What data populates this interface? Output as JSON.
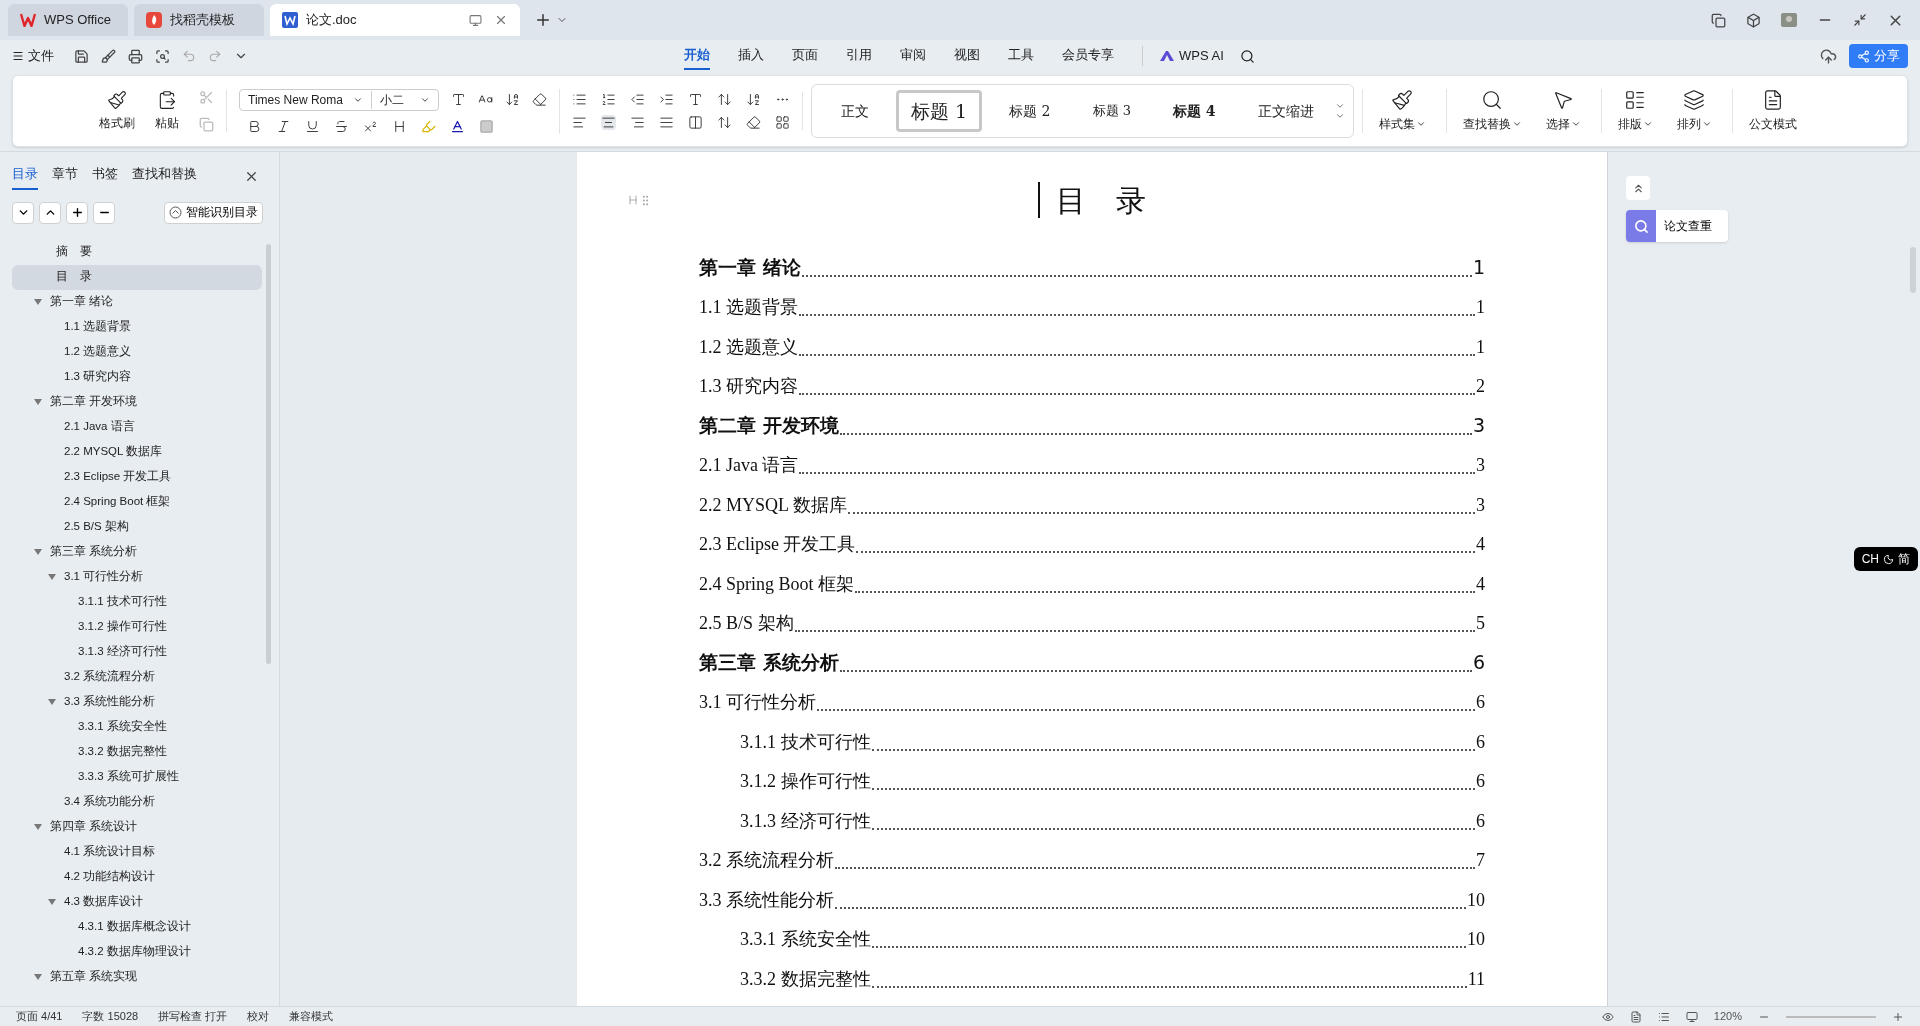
{
  "tabs": [
    {
      "kind": "wps",
      "label": "WPS Office",
      "selected": false
    },
    {
      "kind": "template",
      "label": "找稻壳模板",
      "selected": false
    },
    {
      "kind": "doc",
      "label": "论文.doc",
      "selected": true
    }
  ],
  "file_menu": "文件",
  "ribbon_tabs": [
    {
      "label": "开始",
      "selected": true
    },
    {
      "label": "插入",
      "selected": false
    },
    {
      "label": "页面",
      "selected": false
    },
    {
      "label": "引用",
      "selected": false
    },
    {
      "label": "审阅",
      "selected": false
    },
    {
      "label": "视图",
      "selected": false
    },
    {
      "label": "工具",
      "selected": false
    },
    {
      "label": "会员专享",
      "selected": false
    }
  ],
  "ai_button": "WPS AI",
  "share_button": "分享",
  "ribbon": {
    "clipboard": [
      "格式刷",
      "粘贴"
    ],
    "font_name": "Times New Roma",
    "font_size": "小二",
    "styles": [
      {
        "kind": "body",
        "label": "正文",
        "selected": false
      },
      {
        "kind": "h1",
        "label": "标题 1",
        "selected": true
      },
      {
        "kind": "h2",
        "label": "标题 2",
        "selected": false
      },
      {
        "kind": "h3",
        "label": "标题 3",
        "selected": false
      },
      {
        "kind": "h4",
        "label": "标题 4",
        "selected": false
      },
      {
        "kind": "body",
        "label": "正文缩进",
        "selected": false
      }
    ],
    "tools": [
      {
        "kind": "style-set",
        "label": "样式集",
        "menu": true
      },
      {
        "kind": "find",
        "label": "查找替换",
        "menu": true
      },
      {
        "kind": "select",
        "label": "选择",
        "menu": true
      },
      {
        "kind": "layout",
        "label": "排版",
        "menu": true
      },
      {
        "kind": "arrange",
        "label": "排列",
        "menu": true
      },
      {
        "kind": "official",
        "label": "公文模式",
        "menu": false
      }
    ]
  },
  "sidebar": {
    "tabs": [
      {
        "label": "目录",
        "selected": true
      },
      {
        "label": "章节",
        "selected": false
      },
      {
        "label": "书签",
        "selected": false
      },
      {
        "label": "查找和替换",
        "selected": false
      }
    ],
    "smart_button": "智能识别目录",
    "outline": [
      {
        "label": "摘　要",
        "selected": false
      },
      {
        "label": "目　录",
        "selected": true
      },
      {
        "label": "第一章  绪论",
        "selected": false,
        "expanded": true,
        "children": [
          {
            "label": "1.1  选题背景",
            "selected": false
          },
          {
            "label": "1.2  选题意义",
            "selected": false
          },
          {
            "label": "1.3  研究内容",
            "selected": false
          }
        ]
      },
      {
        "label": "第二章  开发环境",
        "selected": false,
        "expanded": true,
        "children": [
          {
            "label": "2.1 Java 语言",
            "selected": false
          },
          {
            "label": "2.2 MYSQL 数据库",
            "selected": false
          },
          {
            "label": "2.3 Eclipse 开发工具",
            "selected": false
          },
          {
            "label": "2.4 Spring Boot 框架",
            "selected": false
          },
          {
            "label": "2.5 B/S 架构",
            "selected": false
          }
        ]
      },
      {
        "label": "第三章  系统分析",
        "selected": false,
        "expanded": true,
        "children": [
          {
            "label": "3.1 可行性分析",
            "selected": false,
            "expanded": true,
            "children": [
              {
                "label": "3.1.1 技术可行性",
                "selected": false
              },
              {
                "label": "3.1.2 操作可行性",
                "selected": false
              },
              {
                "label": "3.1.3 经济可行性",
                "selected": false
              }
            ]
          },
          {
            "label": "3.2 系统流程分析",
            "selected": false
          },
          {
            "label": "3.3 系统性能分析",
            "selected": false,
            "expanded": true,
            "children": [
              {
                "label": "3.3.1 系统安全性",
                "selected": false
              },
              {
                "label": "3.3.2 数据完整性",
                "selected": false
              },
              {
                "label": "3.3.3 系统可扩展性",
                "selected": false
              }
            ]
          },
          {
            "label": "3.4 系统功能分析",
            "selected": false
          }
        ]
      },
      {
        "label": "第四章  系统设计",
        "selected": false,
        "expanded": true,
        "children": [
          {
            "label": "4.1  系统设计目标",
            "selected": false
          },
          {
            "label": "4.2 功能结构设计",
            "selected": false
          },
          {
            "label": "4.3 数据库设计",
            "selected": false,
            "expanded": true,
            "children": [
              {
                "label": "4.3.1  数据库概念设计",
                "selected": false
              },
              {
                "label": "4.3.2  数据库物理设计",
                "selected": false
              }
            ]
          }
        ]
      },
      {
        "label": "第五章  系统实现",
        "selected": false,
        "expanded": true
      }
    ]
  },
  "document": {
    "title": "目　录",
    "toc": [
      {
        "kind": "chapter",
        "label": "第一章  绪论",
        "page": "1"
      },
      {
        "kind": "section",
        "label": "1.1  选题背景",
        "page": "1"
      },
      {
        "kind": "section",
        "label": "1.2  选题意义",
        "page": "1"
      },
      {
        "kind": "section",
        "label": "1.3  研究内容",
        "page": "2"
      },
      {
        "kind": "chapter",
        "label": "第二章  开发环境",
        "page": "3"
      },
      {
        "kind": "section",
        "label": "2.1 Java 语言",
        "page": "3"
      },
      {
        "kind": "section",
        "label": "2.2 MYSQL 数据库",
        "page": "3"
      },
      {
        "kind": "section",
        "label": "2.3 Eclipse 开发工具",
        "page": "4"
      },
      {
        "kind": "section",
        "label": "2.4 Spring Boot 框架",
        "page": "4"
      },
      {
        "kind": "section",
        "label": "2.5 B/S 架构",
        "page": "5"
      },
      {
        "kind": "chapter",
        "label": "第三章  系统分析",
        "page": "6"
      },
      {
        "kind": "section",
        "label": "3.1 可行性分析",
        "page": "6"
      },
      {
        "kind": "subsection",
        "label": "3.1.1 技术可行性",
        "page": "6"
      },
      {
        "kind": "subsection",
        "label": "3.1.2 操作可行性",
        "page": "6"
      },
      {
        "kind": "subsection",
        "label": "3.1.3 经济可行性",
        "page": "6"
      },
      {
        "kind": "section",
        "label": "3.2 系统流程分析",
        "page": "7"
      },
      {
        "kind": "section",
        "label": "3.3 系统性能分析",
        "page": "10"
      },
      {
        "kind": "subsection",
        "label": "3.3.1 系统安全性",
        "page": "10"
      },
      {
        "kind": "subsection",
        "label": "3.3.2 数据完整性",
        "page": "11"
      }
    ]
  },
  "right_panel": {
    "check_button": "论文查重",
    "ime_mode": "CH",
    "ime_script": "简"
  },
  "status_bar": {
    "items": [
      "页面 4/41",
      "字数 15028",
      "拼写检查 打开",
      "校对",
      "兼容模式"
    ],
    "zoom": "120%"
  }
}
